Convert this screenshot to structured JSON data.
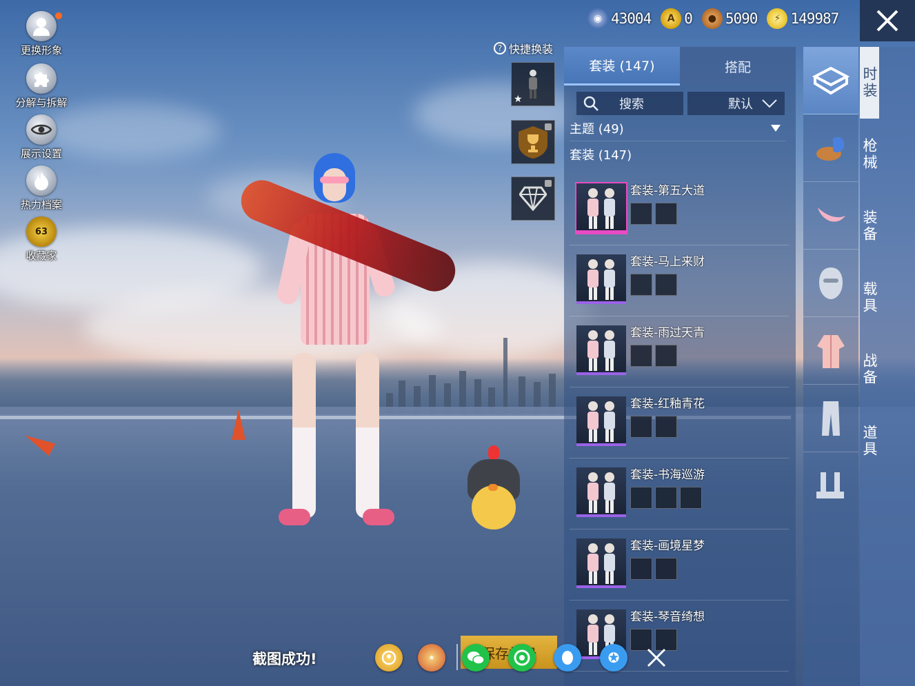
{
  "left_menu": [
    {
      "label": "更换形象",
      "icon": "avatar-icon"
    },
    {
      "label": "分解与拆解",
      "icon": "puzzle-icon"
    },
    {
      "label": "展示设置",
      "icon": "eye-icon"
    },
    {
      "label": "热力档案",
      "icon": "flame-icon"
    },
    {
      "label": "收藏家",
      "icon": "collector-badge-icon",
      "badge": "63"
    }
  ],
  "currencies": [
    {
      "icon": "uc-coin-icon",
      "value": "43004",
      "color": "#4a6fb0"
    },
    {
      "icon": "a-coin-icon",
      "value": "0",
      "color": "#d6a10e"
    },
    {
      "icon": "bp-coin-icon",
      "value": "5090",
      "color": "#b56d2a"
    },
    {
      "icon": "lightning-coin-icon",
      "value": "149987",
      "color": "#e8c22a"
    }
  ],
  "quick_change": {
    "label": "快捷换装"
  },
  "tabs": [
    {
      "label": "套装 (147)",
      "active": true
    },
    {
      "label": "搭配",
      "active": false
    }
  ],
  "search": {
    "placeholder": "搜索",
    "sort": "默认"
  },
  "filters": {
    "theme": "主题 (49)",
    "suits": "套装 (147)"
  },
  "items": [
    {
      "title": "套装-第五大道",
      "minis": 2,
      "rarity": "pink"
    },
    {
      "title": "套装-马上来财",
      "minis": 2,
      "rarity": "purple"
    },
    {
      "title": "套装-雨过天青",
      "minis": 2,
      "rarity": "purple"
    },
    {
      "title": "套装-红釉青花",
      "minis": 2,
      "rarity": "purple"
    },
    {
      "title": "套装-书海巡游",
      "minis": 3,
      "rarity": "purple"
    },
    {
      "title": "套装-画境星梦",
      "minis": 2,
      "rarity": "purple"
    },
    {
      "title": "套装-琴音绮想",
      "minis": 2,
      "rarity": "purple"
    }
  ],
  "categories": [
    {
      "label": "时装",
      "active": true
    },
    {
      "label": "枪械",
      "active": false
    },
    {
      "label": "装备",
      "active": false
    },
    {
      "label": "载具",
      "active": false
    },
    {
      "label": "战备",
      "active": false
    },
    {
      "label": "道具",
      "active": false
    }
  ],
  "category_icons": [
    "wardrobe-icon",
    "hat-icon",
    "crescent-icon",
    "mask-icon",
    "suit-icon",
    "pants-icon",
    "boots-icon"
  ],
  "bottom": {
    "screenshot_msg": "截图成功!",
    "save_label": "保存相册"
  }
}
